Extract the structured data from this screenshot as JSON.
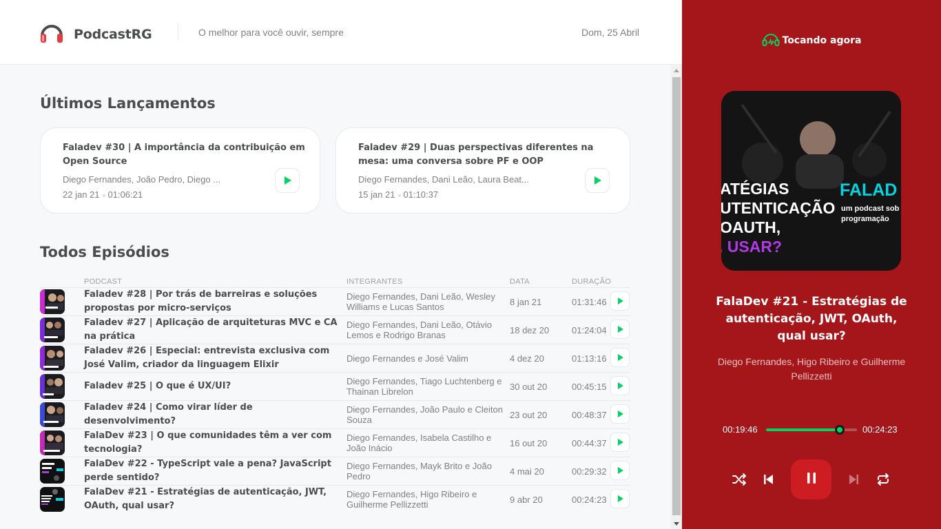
{
  "header": {
    "app_name": "PodcastRG",
    "tagline": "O melhor para você ouvir, sempre",
    "date": "Dom, 25 Abril"
  },
  "latest": {
    "title": "Últimos Lançamentos",
    "cards": [
      {
        "title": "Faladev #30 | A importância da contribuição em Open Source",
        "members": "Diego Fernandes, João Pedro, Diego ...",
        "date": "22 jan 21",
        "duration": "01:06:21"
      },
      {
        "title": "Faladev #29 | Duas perspectivas diferentes na mesa: uma conversa sobre PF e OOP",
        "members": "Diego Fernandes, Dani Leão, Laura Beat...",
        "date": "15 jan 21",
        "duration": "01:10:37"
      }
    ]
  },
  "all": {
    "title": "Todos Episódios",
    "columns": [
      "PODCAST",
      "INTEGRANTES",
      "DATA",
      "DURAÇÃO"
    ],
    "rows": [
      {
        "title": "Faladev #28 | Por trás de barreiras e soluções propostas por micro-serviços",
        "members": "Diego Fernandes, Dani Leão, Wesley Williams e Lucas Santos",
        "date": "8 jan 21",
        "duration": "01:31:46"
      },
      {
        "title": "Faladev #27 | Aplicação de arquiteturas MVC e CA na prática",
        "members": "Diego Fernandes, Dani Leão, Otávio Lemos e Rodrigo Branas",
        "date": "18 dez 20",
        "duration": "01:24:04"
      },
      {
        "title": "Faladev #26 | Especial: entrevista exclusiva com José Valim, criador da linguagem Elixir",
        "members": "Diego Fernandes e José Valim",
        "date": "4 dez 20",
        "duration": "01:13:16"
      },
      {
        "title": "Faladev #25 | O que é UX/UI?",
        "members": "Diego Fernandes, Tiago Luchtenberg e Thainan Librelon",
        "date": "30 out 20",
        "duration": "00:45:15"
      },
      {
        "title": "Faladev #24 | Como virar líder de desenvolvimento?",
        "members": "Diego Fernandes, João Paulo e Cleiton Souza",
        "date": "23 out 20",
        "duration": "00:48:37"
      },
      {
        "title": "FalaDev #23 | O que comunidades têm a ver com tecnologia?",
        "members": "Diego Fernandes, Isabela Castilho e João Inácio",
        "date": "16 out 20",
        "duration": "00:44:37"
      },
      {
        "title": "FalaDev #22 - TypeScript vale a pena? JavaScript perde sentido?",
        "members": "Diego Fernandes, Mayk Brito e João Pedro",
        "date": "4 mai 20",
        "duration": "00:29:32"
      },
      {
        "title": "FalaDev #21 - Estratégias de autenticação, JWT, OAuth, qual usar?",
        "members": "Diego Fernandes, Higo Ribeiro e Guilherme Pellizzetti",
        "date": "9 abr 20",
        "duration": "00:24:23"
      }
    ]
  },
  "player": {
    "label": "Tocando agora",
    "cover_text": {
      "line1": "ATÉGIAS",
      "line2": "UTENTICAÇÃO",
      "line3": "OAUTH,",
      "line4": ". USAR?",
      "brand": "FALAD",
      "sub1": "um podcast sob",
      "sub2": "programação"
    },
    "title": "FalaDev #21 - Estratégias de autenticação, JWT, OAuth, qual usar?",
    "members": "Diego Fernandes, Higo Ribeiro e Guilherme Pellizzetti",
    "current_time": "00:19:46",
    "total_time": "00:24:23",
    "progress": 0.81
  },
  "colors": {
    "player_bg": "#a4161a",
    "accent_green": "#04d361",
    "play_button": "#cd1d22"
  }
}
